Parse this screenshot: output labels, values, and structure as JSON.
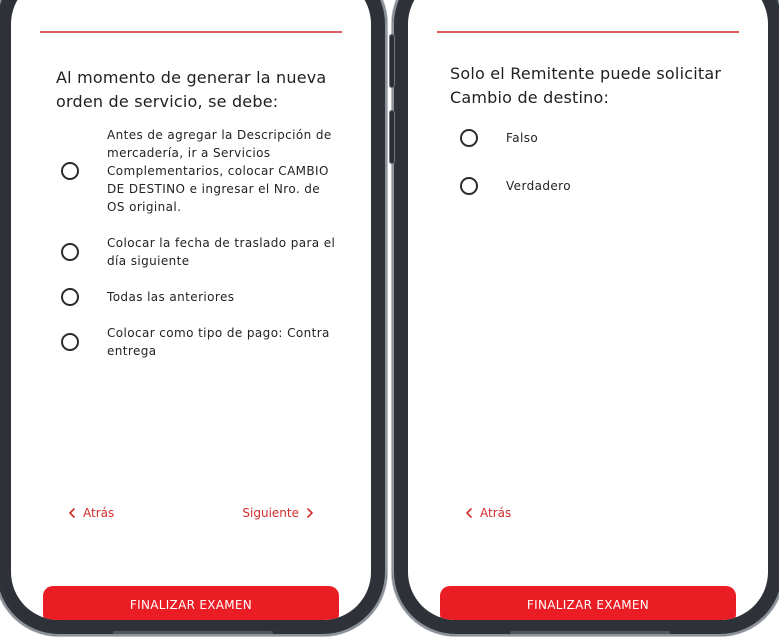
{
  "left_phone": {
    "question": "Al momento de generar la nueva orden de servicio, se debe:",
    "options": [
      "Antes de agregar la Descripción de mercadería, ir a Servicios Complementarios, colocar CAMBIO DE DESTINO e ingresar el Nro. de OS original.",
      "Colocar la fecha de traslado para el día siguiente",
      "Todas las anteriores",
      "Colocar como tipo de pago: Contra entrega"
    ],
    "nav": {
      "back_label": "Atrás",
      "next_label": "Siguiente"
    },
    "finish_label": "FINALIZAR EXAMEN"
  },
  "right_phone": {
    "question": "Solo el Remitente puede solicitar Cambio de destino:",
    "options": [
      "Falso",
      "Verdadero"
    ],
    "nav": {
      "back_label": "Atrás"
    },
    "finish_label": "FINALIZAR EXAMEN"
  },
  "icons": {
    "back": "chevron-left-icon",
    "next": "chevron-right-icon",
    "radio": "radio-unchecked-icon"
  },
  "colors": {
    "accent": "#ea1d24",
    "link": "#d32d2d",
    "divider": "#d94c4c",
    "text": "#1e1f22"
  }
}
